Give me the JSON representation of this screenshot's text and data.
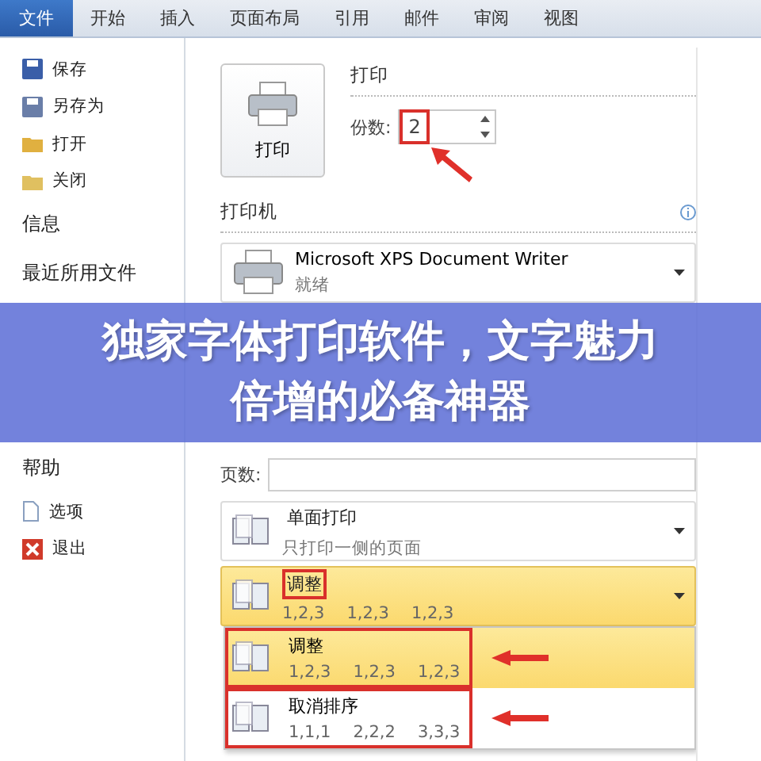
{
  "ribbon_tabs": [
    {
      "label": "文件",
      "selected": true
    },
    {
      "label": "开始",
      "selected": false
    },
    {
      "label": "插入",
      "selected": false
    },
    {
      "label": "页面布局",
      "selected": false
    },
    {
      "label": "引用",
      "selected": false
    },
    {
      "label": "邮件",
      "selected": false
    },
    {
      "label": "审阅",
      "selected": false
    },
    {
      "label": "视图",
      "selected": false
    }
  ],
  "sidebar": {
    "top_items": [
      {
        "label": "保存",
        "kind": "command",
        "selected": false
      },
      {
        "label": "另存为",
        "kind": "command",
        "selected": false
      },
      {
        "label": "打开",
        "kind": "command",
        "selected": false
      },
      {
        "label": "关闭",
        "kind": "command",
        "selected": false
      },
      {
        "label": "信息",
        "kind": "section",
        "selected": false
      },
      {
        "label": "最近所用文件",
        "kind": "section",
        "selected": false
      }
    ],
    "bottom_items": [
      {
        "label": "帮助",
        "kind": "section",
        "selected": false
      },
      {
        "label": "选项",
        "kind": "command",
        "selected": false
      },
      {
        "label": "退出",
        "kind": "command",
        "selected": false
      }
    ]
  },
  "print": {
    "button_label": "打印",
    "heading": "打印",
    "copies_label": "份数:",
    "copies_value": "2",
    "copies_marked": true
  },
  "printer": {
    "heading": "打印机",
    "name": "Microsoft XPS Document Writer",
    "status": "就绪"
  },
  "settings": {
    "pages_label": "页数:",
    "sides": {
      "title": "单面打印",
      "subtitle": "只打印一侧的页面"
    },
    "collation": {
      "title": "调整",
      "values": [
        "1,2,3",
        "1,2,3",
        "1,2,3"
      ],
      "marked": true
    },
    "collation_menu": [
      {
        "title": "调整",
        "values": [
          "1,2,3",
          "1,2,3",
          "1,2,3"
        ],
        "selected": true,
        "marked": true
      },
      {
        "title": "取消排序",
        "values": [
          "1,1,1",
          "2,2,2",
          "3,3,3"
        ],
        "selected": false,
        "marked": true
      }
    ]
  },
  "banner": {
    "lines": [
      "独家字体打印软件，文字魅力",
      "倍增的必备神器"
    ]
  }
}
